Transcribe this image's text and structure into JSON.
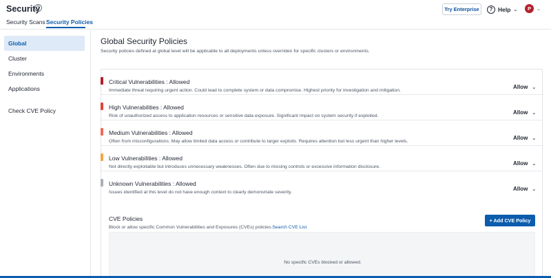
{
  "header": {
    "title": "Security",
    "tabs": [
      "Security Scans",
      "Security Policies"
    ],
    "try_enterprise": "Try Enterprise",
    "help": "Help",
    "avatar_initial": "P"
  },
  "sidebar": {
    "items": [
      "Global",
      "Cluster",
      "Environments",
      "Applications",
      "Check CVE Policy"
    ]
  },
  "main": {
    "title": "Global Security Policies",
    "description": "Security policies defined at global level will be applicable to all deployments unless overriden for specific clusters or environments."
  },
  "vulnerabilities": [
    {
      "title": "Critical Vulnerabilities : Allowed",
      "description": "Immediate threat requiring urgent action. Could lead to complete system or data compromise. Highest priority for investigation and mitigation.",
      "value": "Allow",
      "color": "#b3202a"
    },
    {
      "title": "High Vulnerabilities : Allowed",
      "description": "Risk of unauthorized access to application resources or sensitive data exposure. Significant impact on system security if exploited.",
      "value": "Allow",
      "color": "#e0443a"
    },
    {
      "title": "Medium Vulnerabilities : Allowed",
      "description": "Often from misconfigurations. May allow limited data access or contribute to larger exploits. Requires attention but less urgent than higher levels.",
      "value": "Allow",
      "color": "#ef6a55"
    },
    {
      "title": "Low Vulnerabilities : Allowed",
      "description": "Not directly exploitable but introduces unnecessary weaknesses. Often due to missing controls or excessive information disclosure.",
      "value": "Allow",
      "color": "#f3a54a"
    },
    {
      "title": "Unknown Vulnerabilities : Allowed",
      "description": "Issues identified at this level do not have enough context to clearly demonstrate severity.",
      "value": "Allow",
      "color": "#a9afb8"
    }
  ],
  "cve": {
    "title": "CVE Policies",
    "description": "Block or allow specific Common Vulnerabilities and Exposures (CVEs) policies.",
    "link": "Search CVE List",
    "add_button": "+ Add CVE Policy",
    "empty": "No specific CVEs blocked or allowed."
  }
}
